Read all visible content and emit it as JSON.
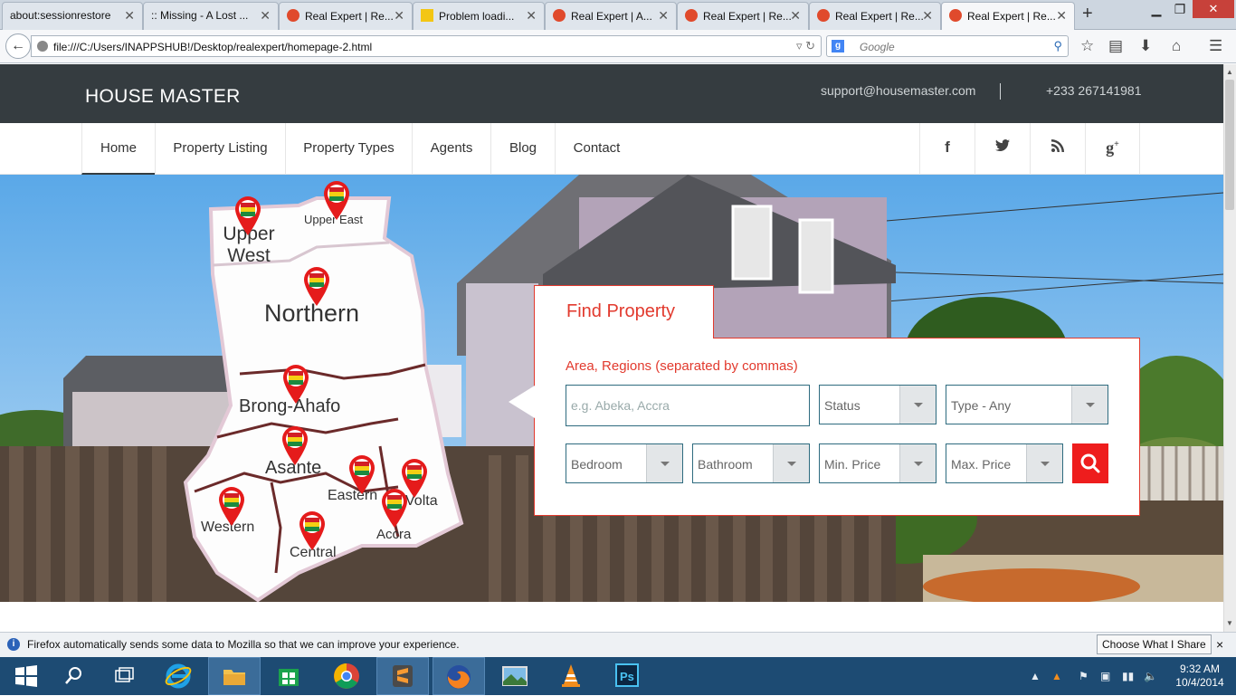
{
  "browser": {
    "tabs": [
      {
        "title": "about:sessionrestore",
        "icon": "document-icon",
        "active": false
      },
      {
        "title": ":: Missing - A Lost ...",
        "icon": "document-icon",
        "active": false
      },
      {
        "title": "Real Expert | Re...",
        "icon": "site-icon",
        "active": false
      },
      {
        "title": "Problem loadi...",
        "icon": "warning-icon",
        "active": false
      },
      {
        "title": "Real Expert | A...",
        "icon": "site-icon",
        "active": false
      },
      {
        "title": "Real Expert | Re...",
        "icon": "site-icon",
        "active": false
      },
      {
        "title": "Real Expert | Re...",
        "icon": "site-icon",
        "active": false
      },
      {
        "title": "Real Expert | Re...",
        "icon": "site-icon",
        "active": true
      }
    ],
    "new_tab": "+",
    "url": "file:///C:/Users/INAPPSHUB!/Desktop/realexpert/homepage-2.html",
    "search_placeholder": "Google",
    "search_engine": "g",
    "infobar_message": "Firefox automatically sends some data to Mozilla so that we can improve your experience.",
    "infobar_button": "Choose What I Share",
    "infobar_close": "×"
  },
  "site": {
    "logo": "HOUSE MASTER",
    "email": "support@housemaster.com",
    "phone": "+233 267141981",
    "nav": [
      "Home",
      "Property Listing",
      "Property Types",
      "Agents",
      "Blog",
      "Contact"
    ],
    "social": [
      {
        "label": "f",
        "icon": "facebook-icon"
      },
      {
        "label": "twitter",
        "icon": "twitter-icon"
      },
      {
        "label": "rss",
        "icon": "rss-icon"
      },
      {
        "label": "g+",
        "icon": "google-plus-icon"
      }
    ],
    "map_regions": [
      "Upper West",
      "Upper East",
      "Northern",
      "Brong-Ahafo",
      "Asante",
      "Eastern",
      "Volta",
      "Western",
      "Central",
      "Accra"
    ],
    "find": {
      "title": "Find Property",
      "area_label": "Area, Regions (separated by commas)",
      "area_placeholder": "e.g. Abeka, Accra",
      "status": "Status",
      "type": "Type - Any",
      "bedroom": "Bedroom",
      "bathroom": "Bathroom",
      "min_price": "Min. Price",
      "max_price": "Max. Price"
    },
    "colors": {
      "accent": "#e23a2e",
      "header": "#353c40",
      "field_border": "#2e6b7f"
    }
  },
  "taskbar": {
    "time": "9:32 AM",
    "date": "10/4/2014",
    "apps": [
      "windows-start-icon",
      "search-icon",
      "task-view-icon",
      "internet-explorer-icon",
      "file-explorer-icon",
      "store-icon",
      "chrome-icon",
      "sublime-text-icon",
      "firefox-icon",
      "photos-icon",
      "vlc-icon",
      "photoshop-icon"
    ]
  }
}
